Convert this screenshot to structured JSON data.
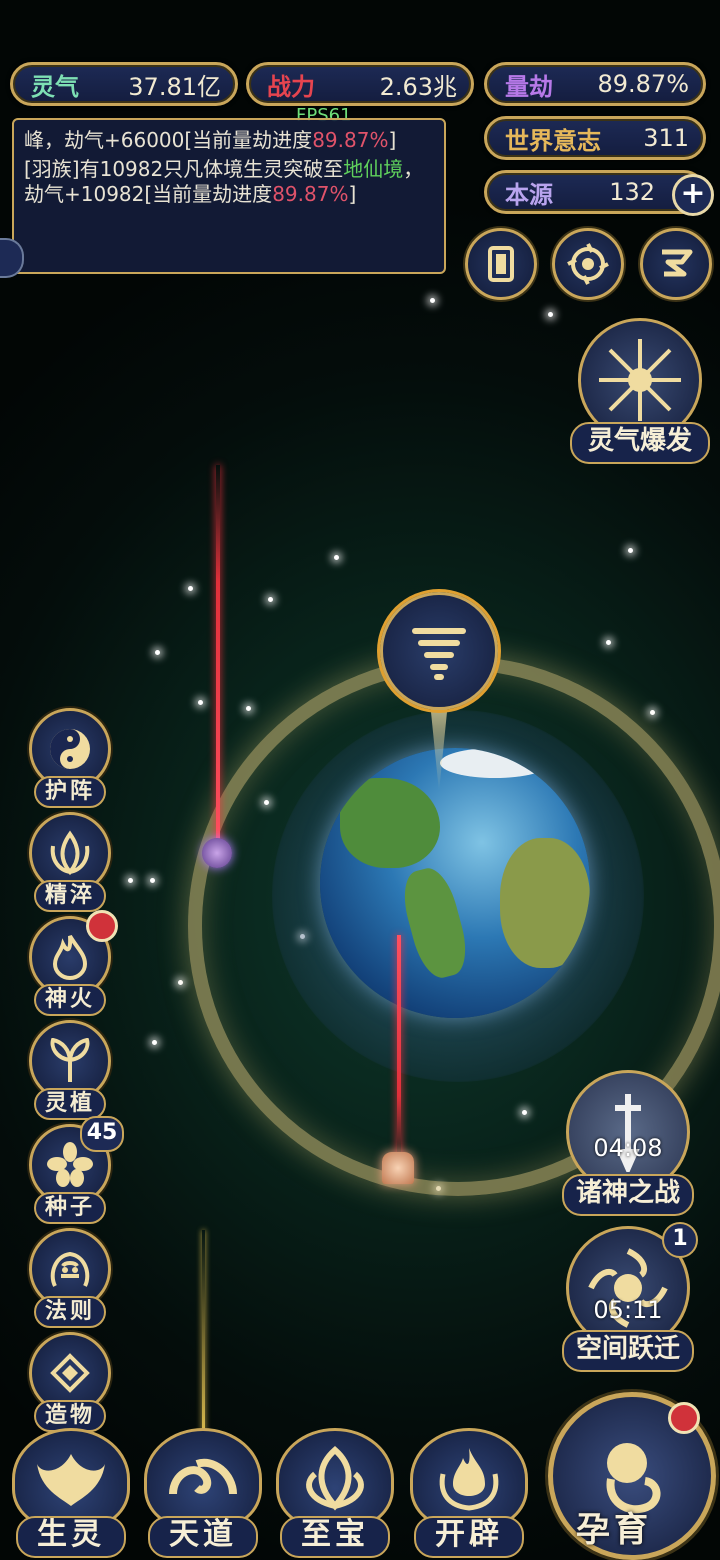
{
  "hud": {
    "stats": [
      {
        "label": "灵气",
        "value": "37.81亿",
        "color": "#7ee0b4"
      },
      {
        "label": "战力",
        "value": "2.63兆",
        "color": "#e6444f"
      },
      {
        "label": "量劫",
        "value": "89.87%",
        "color": "#b779e8"
      },
      {
        "label": "世界意志",
        "value": "311",
        "color": "#e6b85a"
      },
      {
        "label": "本源",
        "value": "132",
        "color": "#b9a4ee"
      }
    ],
    "fps": "FPS61"
  },
  "log": {
    "line1_prefix": "峰，劫气+66000[当前量劫进度",
    "line1_pct": "89.87%",
    "line1_suffix": "]",
    "line2_prefix": "[羽族]有10982只凡体境生灵突破至",
    "line2_realm": "地仙境",
    "line2_mid": "，劫气+10982[当前量劫进度",
    "line2_pct": "89.87%",
    "line2_suffix": "]"
  },
  "side_menu": [
    {
      "label": "护阵",
      "icon": "taiji-icon"
    },
    {
      "label": "精淬",
      "icon": "lotus-flame-icon"
    },
    {
      "label": "神火",
      "icon": "fire-icon",
      "badge": true
    },
    {
      "label": "灵植",
      "icon": "plant-icon"
    },
    {
      "label": "种子",
      "icon": "seed-icon",
      "count": "45"
    },
    {
      "label": "法则",
      "icon": "rune-icon"
    },
    {
      "label": "造物",
      "icon": "creation-icon"
    }
  ],
  "right_menu": {
    "burst": "灵气爆发",
    "war": {
      "label": "诸神之战",
      "timer": "04:08"
    },
    "jump": {
      "label": "空间跃迁",
      "timer": "05:11",
      "count": "1"
    },
    "nurture": "孕育"
  },
  "bottom_nav": [
    "生灵",
    "天道",
    "至宝",
    "开辟"
  ],
  "colors": {
    "gold": "#c9a65a",
    "panel": "#17234a",
    "badge": "#d0323a"
  }
}
